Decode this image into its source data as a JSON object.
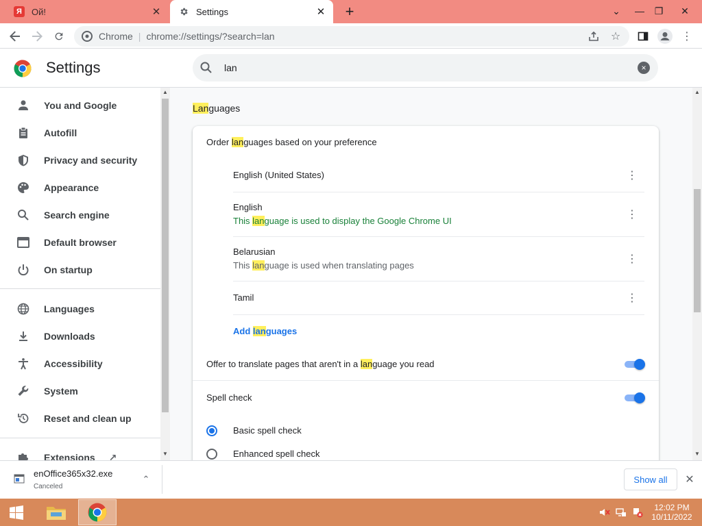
{
  "tabs": [
    {
      "title": "Ой!",
      "favicon": "Я",
      "active": false
    },
    {
      "title": "Settings",
      "active": true
    }
  ],
  "omnibox": {
    "chip": "Chrome",
    "url": "chrome://settings/?search=lan"
  },
  "header": {
    "title": "Settings",
    "search_value": "lan",
    "search_clear": "×"
  },
  "sidebar": {
    "items": [
      {
        "label": "You and Google",
        "icon": "person-icon"
      },
      {
        "label": "Autofill",
        "icon": "clipboard-icon"
      },
      {
        "label": "Privacy and security",
        "icon": "shield-icon"
      },
      {
        "label": "Appearance",
        "icon": "palette-icon"
      },
      {
        "label": "Search engine",
        "icon": "search-icon"
      },
      {
        "label": "Default browser",
        "icon": "browser-icon"
      },
      {
        "label": "On startup",
        "icon": "power-icon"
      },
      {
        "label": "Languages",
        "icon": "globe-icon"
      },
      {
        "label": "Downloads",
        "icon": "download-icon"
      },
      {
        "label": "Accessibility",
        "icon": "accessibility-icon"
      },
      {
        "label": "System",
        "icon": "wrench-icon"
      },
      {
        "label": "Reset and clean up",
        "icon": "history-icon"
      },
      {
        "label": "Extensions",
        "icon": "puzzle-icon"
      }
    ]
  },
  "main": {
    "section": {
      "hl": "Lan",
      "rest": "guages"
    },
    "order": {
      "before": "Order ",
      "hl": "lan",
      "after": "guages based on your preference"
    },
    "languages": [
      {
        "name": "English (United States)"
      },
      {
        "name": "English",
        "sub_before": "This ",
        "sub_hl": "lan",
        "sub_after": "guage is used to display the Google Chrome UI"
      },
      {
        "name": "Belarusian",
        "sub_before": "This ",
        "sub_hl": "lan",
        "sub_after": "guage is used when translating pages"
      },
      {
        "name": "Tamil"
      }
    ],
    "add_languages": {
      "before": "Add ",
      "hl": "lan",
      "after": "guages"
    },
    "offer_translate": {
      "before": "Offer to translate pages that aren't in a ",
      "hl": "lan",
      "after": "guage you read",
      "enabled": true
    },
    "spell_check": {
      "label": "Spell check",
      "enabled": true
    },
    "spell_options": [
      {
        "label": "Basic spell check",
        "selected": true
      },
      {
        "label": "Enhanced spell check",
        "selected": false
      }
    ]
  },
  "download_bar": {
    "file_name": "enOffice365x32.exe",
    "status": "Canceled",
    "show_all": "Show all"
  },
  "taskbar": {
    "time": "12:02 PM",
    "date": "10/11/2022"
  },
  "colors": {
    "tabstrip": "#f28b82",
    "accent": "#1a73e8",
    "highlight": "#ffef5c",
    "taskbar": "#d8895a"
  }
}
